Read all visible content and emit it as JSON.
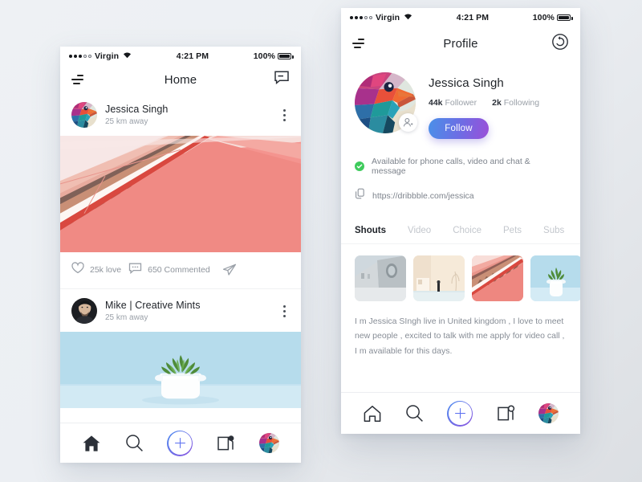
{
  "background_color": "#eef1f4",
  "accent": {
    "gradient_from": "#4a90e8",
    "gradient_to": "#9b4fd8",
    "plus": "#5a6ef0",
    "online": "#3ecb5c"
  },
  "home_screen": {
    "status_bar": {
      "carrier": "Virgin",
      "time": "4:21 PM",
      "battery": "100%"
    },
    "nav": {
      "title": "Home",
      "menu_icon": "filter-sort-icon",
      "right_icon": "message-bubble-icon"
    },
    "posts": [
      {
        "author": "Jessica Singh",
        "distance": "25 km away",
        "avatar_icon": "bird-avatar",
        "more_icon": "kebab-menu-icon",
        "photo_name": "pink-escalator-photo",
        "actions": {
          "like_icon": "heart-icon",
          "like_label": "25k love",
          "comment_icon": "comment-icon",
          "comment_label": "650 Commented",
          "share_icon": "send-paperplane-icon"
        }
      },
      {
        "author": "Mike | Creative Mints",
        "distance": "25 km away",
        "avatar_icon": "man-portrait-avatar",
        "more_icon": "kebab-menu-icon",
        "photo_name": "blue-succulent-plant-photo"
      }
    ],
    "tabbar": [
      {
        "name": "home-tab",
        "icon": "home-icon-filled",
        "active": true
      },
      {
        "name": "search-tab",
        "icon": "search-icon",
        "active": false
      },
      {
        "name": "add-tab",
        "icon": "plus-icon",
        "active": false
      },
      {
        "name": "notifications-tab",
        "icon": "notification-square-icon",
        "active": false
      },
      {
        "name": "profile-tab",
        "icon": "bird-avatar",
        "active": false
      }
    ]
  },
  "profile_screen": {
    "status_bar": {
      "carrier": "Virgin",
      "time": "4:21 PM",
      "battery": "100%"
    },
    "nav": {
      "title": "Profile",
      "menu_icon": "filter-sort-icon",
      "right_icon": "history-clock-icon"
    },
    "profile": {
      "name": "Jessica Singh",
      "followers_value": "44k",
      "followers_label": "Follower",
      "following_value": "2k",
      "following_label": "Following",
      "follow_button": "Follow",
      "avatar_icon": "bird-avatar",
      "avatar_badge_icon": "add-person-icon"
    },
    "details": [
      {
        "icon": "check-circle-icon",
        "text": "Available for phone calls, video and chat & message"
      },
      {
        "icon": "link-icon",
        "text": "https://dribbble.com/jessica"
      }
    ],
    "tabs": [
      {
        "label": "Shouts",
        "active": true
      },
      {
        "label": "Video",
        "active": false
      },
      {
        "label": "Choice",
        "active": false
      },
      {
        "label": "Pets",
        "active": false
      },
      {
        "label": "Subs",
        "active": false
      }
    ],
    "thumbnails": [
      {
        "name": "grey-architecture-thumb"
      },
      {
        "name": "beige-interior-thumb"
      },
      {
        "name": "pink-stairs-thumb"
      },
      {
        "name": "blue-plant-thumb"
      }
    ],
    "bio": "I m Jessica SIngh live in United kingdom , I love to meet new people , excited to talk with me apply for video call , I m available for this days.",
    "tabbar": [
      {
        "name": "home-tab",
        "icon": "home-icon-outline",
        "active": false
      },
      {
        "name": "search-tab",
        "icon": "search-icon",
        "active": false
      },
      {
        "name": "add-tab",
        "icon": "plus-icon",
        "active": false
      },
      {
        "name": "notifications-tab",
        "icon": "notification-square-icon",
        "active": false
      },
      {
        "name": "profile-tab",
        "icon": "bird-avatar",
        "active": true
      }
    ]
  }
}
